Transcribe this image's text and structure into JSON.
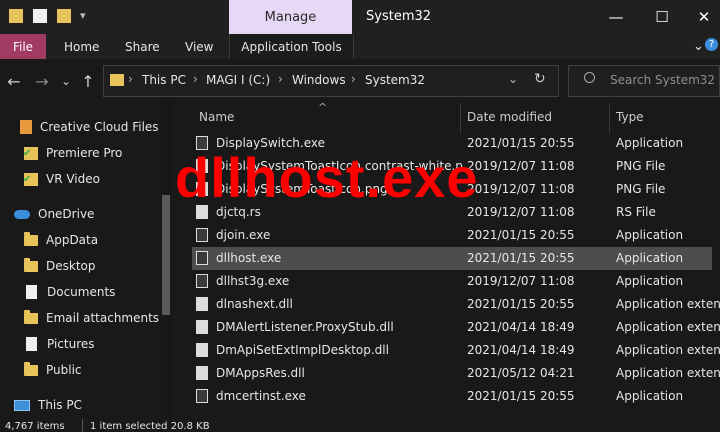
{
  "window": {
    "title": "System32",
    "manage_tab": "Manage",
    "minimize": "—",
    "maximize": "☐",
    "close": "✕"
  },
  "ribbon": {
    "file": "File",
    "home": "Home",
    "share": "Share",
    "view": "View",
    "app_tools": "Application Tools",
    "expand": "⌄",
    "help": "?"
  },
  "address": {
    "back": "←",
    "forward": "→",
    "recent": "⌄",
    "up": "↑",
    "crumbs": [
      "This PC",
      "MAGI I (C:)",
      "Windows",
      "System32"
    ],
    "dropdown": "⌄",
    "refresh": "↻",
    "search_placeholder": "Search System32"
  },
  "sidebar": {
    "items": [
      {
        "label": "Creative Cloud Files",
        "icon": "creative-cloud-icon"
      },
      {
        "label": "Premiere Pro",
        "icon": "folder-synced-icon"
      },
      {
        "label": "VR Video",
        "icon": "folder-synced-icon"
      },
      {
        "label": "OneDrive",
        "icon": "onedrive-cloud-icon"
      },
      {
        "label": "AppData",
        "icon": "folder-icon"
      },
      {
        "label": "Desktop",
        "icon": "folder-icon"
      },
      {
        "label": "Documents",
        "icon": "document-icon"
      },
      {
        "label": "Email attachments",
        "icon": "folder-icon"
      },
      {
        "label": "Pictures",
        "icon": "document-icon"
      },
      {
        "label": "Public",
        "icon": "folder-icon"
      },
      {
        "label": "This PC",
        "icon": "this-pc-icon"
      }
    ]
  },
  "columns": {
    "sort_arrow": "^",
    "name": "Name",
    "date": "Date modified",
    "type": "Type"
  },
  "files": [
    {
      "name": "DisplaySwitch.exe",
      "date": "2021/01/15 20:55",
      "type": "Application"
    },
    {
      "name": "DisplaySystemToastIcon.contrast-white.p",
      "date": "2019/12/07 11:08",
      "type": "PNG File"
    },
    {
      "name": "DisplaySystemToastIcon.png",
      "date": "2019/12/07 11:08",
      "type": "PNG File"
    },
    {
      "name": "djctq.rs",
      "date": "2019/12/07 11:08",
      "type": "RS File"
    },
    {
      "name": "djoin.exe",
      "date": "2021/01/15 20:55",
      "type": "Application"
    },
    {
      "name": "dllhost.exe",
      "date": "2021/01/15 20:55",
      "type": "Application",
      "selected": true
    },
    {
      "name": "dllhst3g.exe",
      "date": "2019/12/07 11:08",
      "type": "Application"
    },
    {
      "name": "dlnashext.dll",
      "date": "2021/01/15 20:55",
      "type": "Application exten."
    },
    {
      "name": "DMAlertListener.ProxyStub.dll",
      "date": "2021/04/14 18:49",
      "type": "Application exten."
    },
    {
      "name": "DmApiSetExtImplDesktop.dll",
      "date": "2021/04/14 18:49",
      "type": "Application exten."
    },
    {
      "name": "DMAppsRes.dll",
      "date": "2021/05/12 04:21",
      "type": "Application exten."
    },
    {
      "name": "dmcertinst.exe",
      "date": "2021/01/15 20:55",
      "type": "Application"
    }
  ],
  "overlay": "dllhost.exe",
  "status": {
    "items": "4,767 items",
    "selected": "1 item selected  20.8 KB"
  }
}
